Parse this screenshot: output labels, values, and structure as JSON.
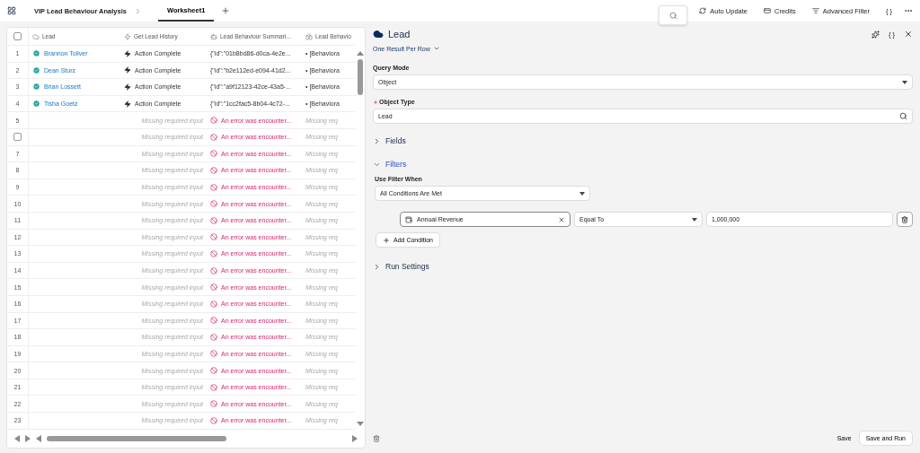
{
  "topbar": {
    "project": "VIP Lead Behaviour Analysis",
    "tabs": [
      {
        "label": "Worksheet1",
        "selected": true
      }
    ],
    "actions": [
      {
        "kind": "refresh",
        "label": "Auto Update"
      },
      {
        "kind": "card",
        "label": "Credits"
      },
      {
        "kind": "filter",
        "label": "Advanced Filter"
      },
      {
        "kind": "text",
        "label": "{ }"
      },
      {
        "kind": "more"
      }
    ]
  },
  "table": {
    "select_all_checked": false,
    "columns": [
      {
        "kind": "cloud",
        "label": "Lead"
      },
      {
        "kind": "bolt",
        "label": "Get Lead History"
      },
      {
        "kind": "agent",
        "label": "Lead Behaviour Summari..."
      },
      {
        "kind": "split",
        "label": "Lead Behavio"
      }
    ],
    "rows": [
      {
        "number": "1",
        "lead": "Brannon Toliver",
        "history": {
          "kind": "complete",
          "text": "Action Complete"
        },
        "summary": {
          "kind": "ok",
          "text": "{\"id\":\"01b8bd86-d0ca-4e2e..."
        },
        "behaviour": {
          "kind": "ok",
          "text": "• [Behaviora"
        }
      },
      {
        "number": "2",
        "lead": "Dean Sturz",
        "history": {
          "kind": "complete",
          "text": "Action Complete"
        },
        "summary": {
          "kind": "ok",
          "text": "{\"id\":\"b2e112ed-e094-41d2..."
        },
        "behaviour": {
          "kind": "ok",
          "text": "• [Behaviora"
        }
      },
      {
        "number": "3",
        "lead": "Brian Lossett",
        "history": {
          "kind": "complete",
          "text": "Action Complete"
        },
        "summary": {
          "kind": "ok",
          "text": "{\"id\":\"a9f12123-42ce-43a5-..."
        },
        "behaviour": {
          "kind": "ok",
          "text": "• [Behaviora"
        }
      },
      {
        "number": "4",
        "lead": "Tisha Goetz",
        "history": {
          "kind": "complete",
          "text": "Action Complete"
        },
        "summary": {
          "kind": "ok",
          "text": "{\"id\":\"1cc2fac5-8b04-4c72-..."
        },
        "behaviour": {
          "kind": "ok",
          "text": "• [Behaviora"
        }
      },
      {
        "number": "5",
        "history": {
          "kind": "missing",
          "text": "Missing required input"
        },
        "summary": {
          "kind": "error",
          "text": "An error was encounter..."
        },
        "behaviour": {
          "kind": "missing",
          "text": "Missing req"
        }
      },
      {
        "checked": false,
        "history": {
          "kind": "missing",
          "text": "Missing required input"
        },
        "summary": {
          "kind": "error",
          "text": "An error was encounter..."
        },
        "behaviour": {
          "kind": "missing",
          "text": "Missing req"
        }
      },
      {
        "number": "7",
        "history": {
          "kind": "missing",
          "text": "Missing required input"
        },
        "summary": {
          "kind": "error",
          "text": "An error was encounter..."
        },
        "behaviour": {
          "kind": "missing",
          "text": "Missing req"
        }
      },
      {
        "number": "8",
        "history": {
          "kind": "missing",
          "text": "Missing required input"
        },
        "summary": {
          "kind": "error",
          "text": "An error was encounter..."
        },
        "behaviour": {
          "kind": "missing",
          "text": "Missing req"
        }
      },
      {
        "number": "9",
        "history": {
          "kind": "missing",
          "text": "Missing required input"
        },
        "summary": {
          "kind": "error",
          "text": "An error was encounter..."
        },
        "behaviour": {
          "kind": "missing",
          "text": "Missing req"
        }
      },
      {
        "number": "10",
        "history": {
          "kind": "missing",
          "text": "Missing required input"
        },
        "summary": {
          "kind": "error",
          "text": "An error was encounter..."
        },
        "behaviour": {
          "kind": "missing",
          "text": "Missing req"
        }
      },
      {
        "number": "11",
        "history": {
          "kind": "missing",
          "text": "Missing required input"
        },
        "summary": {
          "kind": "error",
          "text": "An error was encounter..."
        },
        "behaviour": {
          "kind": "missing",
          "text": "Missing req"
        }
      },
      {
        "number": "12",
        "history": {
          "kind": "missing",
          "text": "Missing required input"
        },
        "summary": {
          "kind": "error",
          "text": "An error was encounter..."
        },
        "behaviour": {
          "kind": "missing",
          "text": "Missing req"
        }
      },
      {
        "number": "13",
        "history": {
          "kind": "missing",
          "text": "Missing required input"
        },
        "summary": {
          "kind": "error",
          "text": "An error was encounter..."
        },
        "behaviour": {
          "kind": "missing",
          "text": "Missing req"
        }
      },
      {
        "number": "14",
        "history": {
          "kind": "missing",
          "text": "Missing required input"
        },
        "summary": {
          "kind": "error",
          "text": "An error was encounter..."
        },
        "behaviour": {
          "kind": "missing",
          "text": "Missing req"
        }
      },
      {
        "number": "15",
        "history": {
          "kind": "missing",
          "text": "Missing required input"
        },
        "summary": {
          "kind": "error",
          "text": "An error was encounter..."
        },
        "behaviour": {
          "kind": "missing",
          "text": "Missing req"
        }
      },
      {
        "number": "16",
        "history": {
          "kind": "missing",
          "text": "Missing required input"
        },
        "summary": {
          "kind": "error",
          "text": "An error was encounter..."
        },
        "behaviour": {
          "kind": "missing",
          "text": "Missing req"
        }
      },
      {
        "number": "17",
        "history": {
          "kind": "missing",
          "text": "Missing required input"
        },
        "summary": {
          "kind": "error",
          "text": "An error was encounter..."
        },
        "behaviour": {
          "kind": "missing",
          "text": "Missing req"
        }
      },
      {
        "number": "18",
        "history": {
          "kind": "missing",
          "text": "Missing required input"
        },
        "summary": {
          "kind": "error",
          "text": "An error was encounter..."
        },
        "behaviour": {
          "kind": "missing",
          "text": "Missing req"
        }
      },
      {
        "number": "19",
        "history": {
          "kind": "missing",
          "text": "Missing required input"
        },
        "summary": {
          "kind": "error",
          "text": "An error was encounter..."
        },
        "behaviour": {
          "kind": "missing",
          "text": "Missing req"
        }
      },
      {
        "number": "20",
        "history": {
          "kind": "missing",
          "text": "Missing required input"
        },
        "summary": {
          "kind": "error",
          "text": "An error was encounter..."
        },
        "behaviour": {
          "kind": "missing",
          "text": "Missing req"
        }
      },
      {
        "number": "21",
        "history": {
          "kind": "missing",
          "text": "Missing required input"
        },
        "summary": {
          "kind": "error",
          "text": "An error was encounter..."
        },
        "behaviour": {
          "kind": "missing",
          "text": "Missing req"
        }
      },
      {
        "number": "22",
        "history": {
          "kind": "missing",
          "text": "Missing required input"
        },
        "summary": {
          "kind": "error",
          "text": "An error was encounter..."
        },
        "behaviour": {
          "kind": "missing",
          "text": "Missing req"
        }
      },
      {
        "number": "23",
        "history": {
          "kind": "missing",
          "text": "Missing required input"
        },
        "summary": {
          "kind": "error",
          "text": "An error was encounter..."
        },
        "behaviour": {
          "kind": "missing",
          "text": "Missing req"
        }
      }
    ]
  },
  "panel": {
    "title": "Lead",
    "json_label": "{ }",
    "mode": "One Result Per Row",
    "query_mode": {
      "label": "Query Mode",
      "value": "Object"
    },
    "object_type": {
      "label": "Object Type",
      "required": true,
      "value": "Lead"
    },
    "sections": [
      {
        "title": "Fields",
        "expanded": false
      },
      {
        "title": "Filters",
        "expanded": true,
        "filter": {
          "label": "Use Filter When",
          "value": "All Conditions Are Met",
          "conditions": [
            {
              "field": "Annual Revenue",
              "operator": "Equal To",
              "value": "1,000,000"
            }
          ],
          "add_label": "Add Condition"
        }
      },
      {
        "title": "Run Settings",
        "expanded": false
      }
    ],
    "footer": {
      "save": "Save",
      "save_run": "Save and Run"
    }
  }
}
